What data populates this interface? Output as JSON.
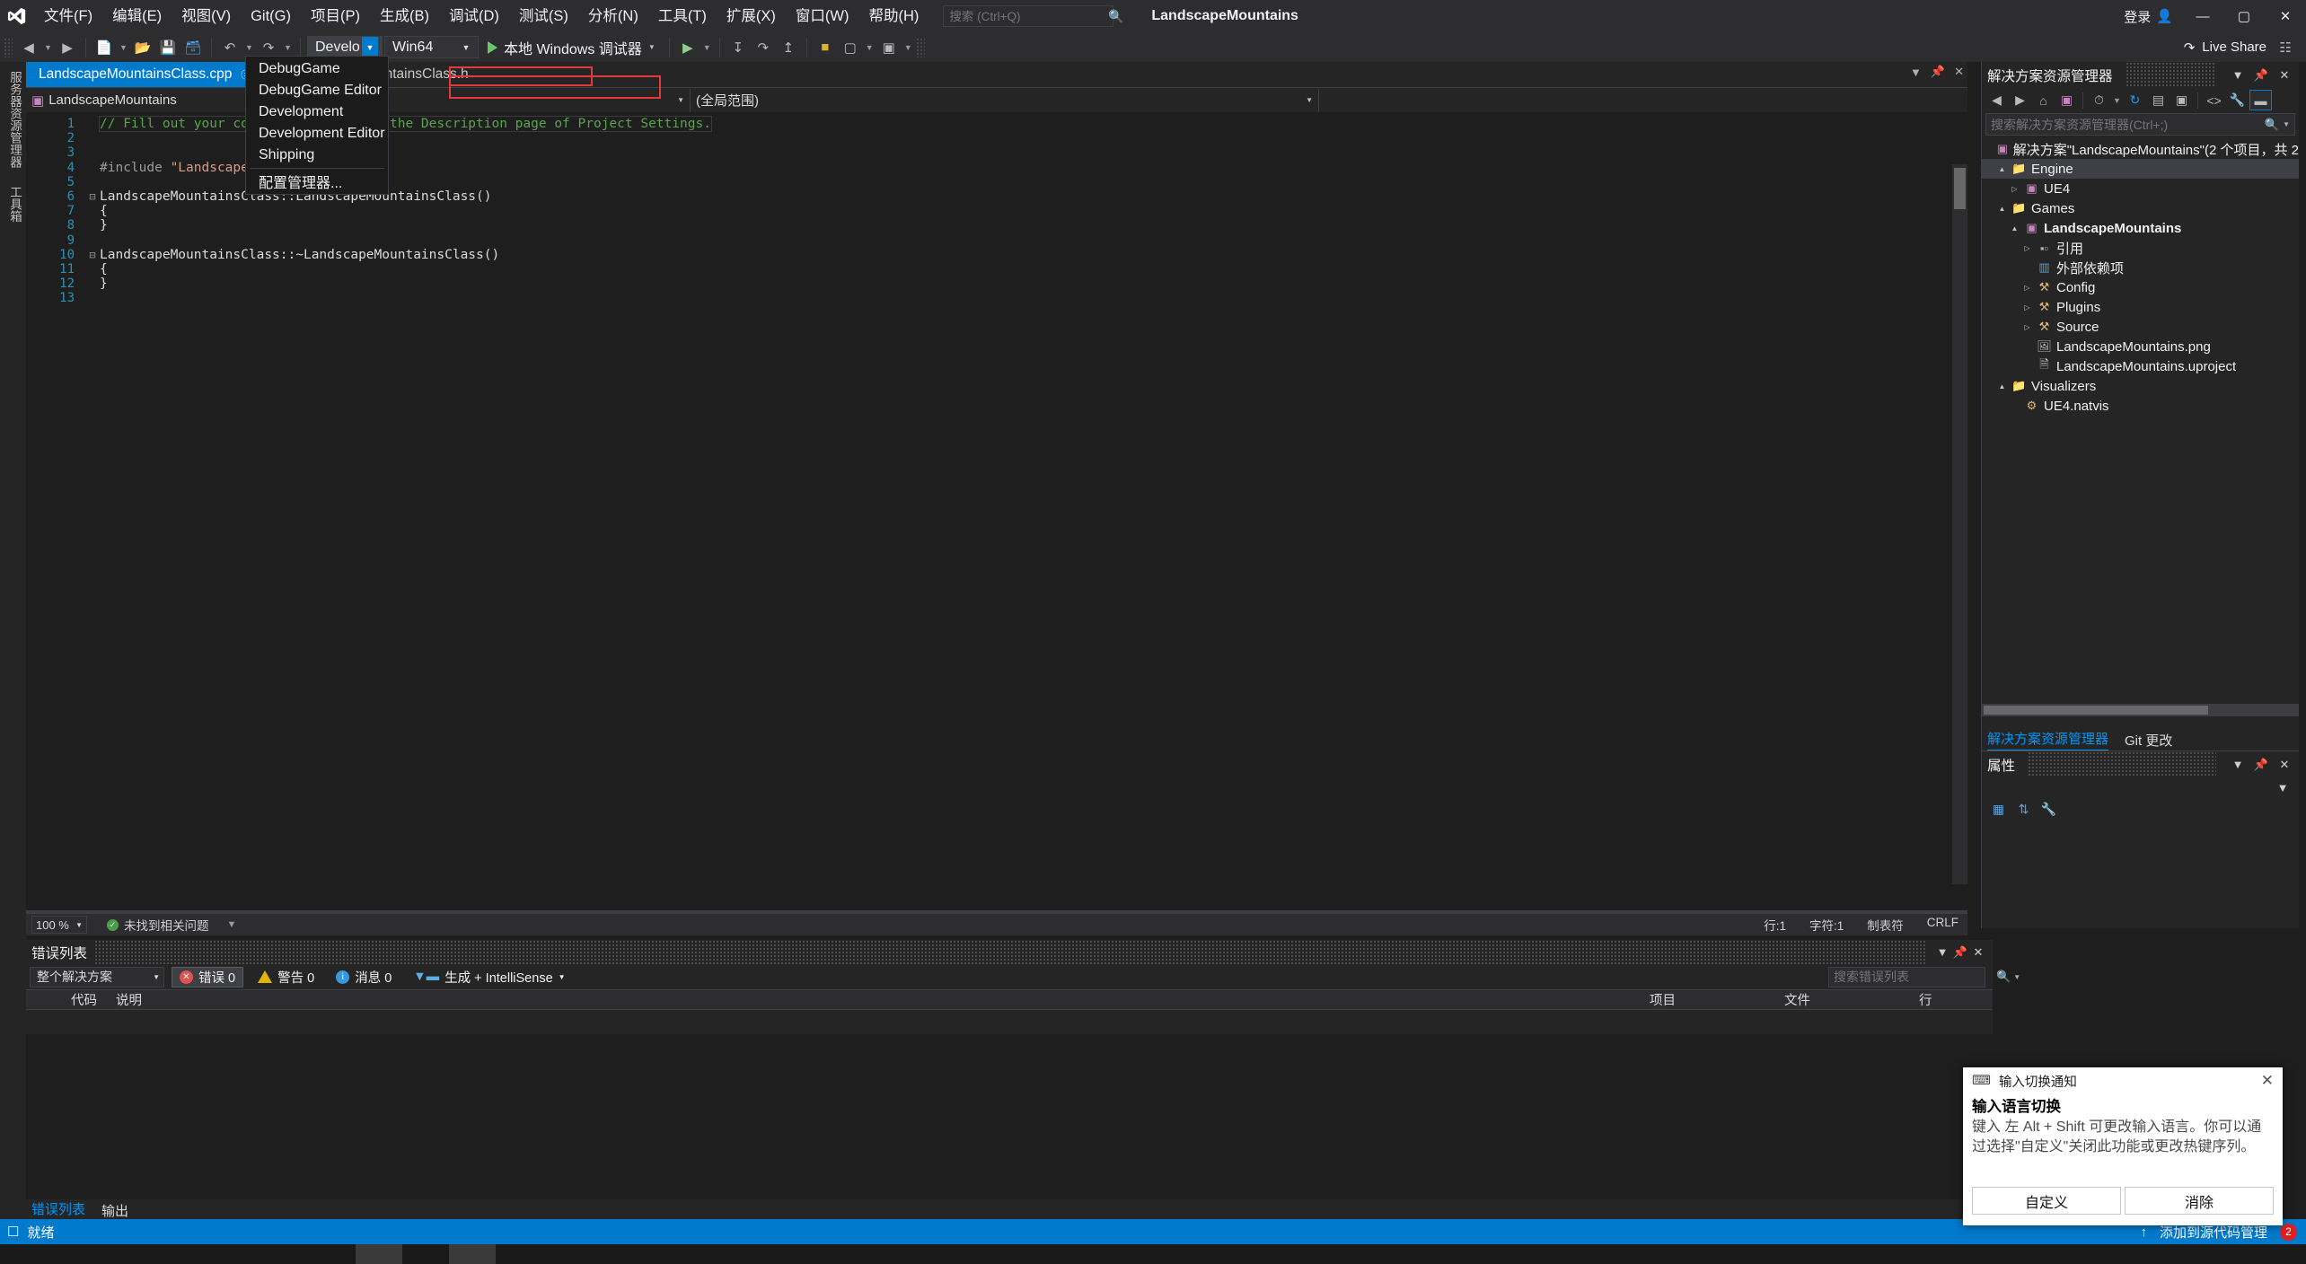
{
  "titlebar": {
    "menus": [
      "文件(F)",
      "编辑(E)",
      "视图(V)",
      "Git(G)",
      "项目(P)",
      "生成(B)",
      "调试(D)",
      "测试(S)",
      "分析(N)",
      "工具(T)",
      "扩展(X)",
      "窗口(W)",
      "帮助(H)"
    ],
    "search_placeholder": "搜索 (Ctrl+Q)",
    "search_value": "",
    "solution_name": "LandscapeMountains",
    "signin_label": "登录",
    "minimize": "—",
    "maximize": "▢",
    "close": "✕"
  },
  "toolbar": {
    "config_value": "Develo",
    "platform_value": "Win64",
    "run_label": "本地 Windows 调试器",
    "live_share": "Live Share"
  },
  "config_menu": {
    "items": [
      "DebugGame",
      "DebugGame Editor",
      "Development",
      "Development Editor",
      "Shipping"
    ],
    "manager": "配置管理器..."
  },
  "left_tabs": [
    "服务器资源管理器",
    "工具箱"
  ],
  "editor": {
    "tab_active": "LandscapeMountainsClass.cpp",
    "tab_inactive": "LandscapeMountainsClass.h",
    "nav_left": "LandscapeMountains",
    "nav_right": "(全局范围)",
    "lines": [
      {
        "num": "1",
        "fold": "",
        "text": "// Fill out your copyright notice in the Description page of Project Settings.",
        "kind": "comment"
      },
      {
        "num": "2",
        "fold": "",
        "text": "",
        "kind": "plain"
      },
      {
        "num": "3",
        "fold": "",
        "text": "",
        "kind": "plain"
      },
      {
        "num": "4",
        "fold": "",
        "text": "#include \"LandscapeMountainsClass.h\"",
        "kind": "include"
      },
      {
        "num": "5",
        "fold": "",
        "text": "",
        "kind": "plain"
      },
      {
        "num": "6",
        "fold": "⊟",
        "text": "LandscapeMountainsClass::LandscapeMountainsClass()",
        "kind": "plain"
      },
      {
        "num": "7",
        "fold": "",
        "text": "{",
        "kind": "plain"
      },
      {
        "num": "8",
        "fold": "",
        "text": "}",
        "kind": "plain"
      },
      {
        "num": "9",
        "fold": "",
        "text": "",
        "kind": "plain"
      },
      {
        "num": "10",
        "fold": "⊟",
        "text": "LandscapeMountainsClass::~LandscapeMountainsClass()",
        "kind": "plain"
      },
      {
        "num": "11",
        "fold": "",
        "text": "{",
        "kind": "plain"
      },
      {
        "num": "12",
        "fold": "",
        "text": "}",
        "kind": "plain"
      },
      {
        "num": "13",
        "fold": "",
        "text": "",
        "kind": "plain"
      }
    ],
    "status": {
      "zoom": "100 %",
      "diagnostics": "未找到相关问题",
      "line": "行:1",
      "col": "字符:1",
      "tabs": "制表符",
      "eol": "CRLF"
    }
  },
  "solution_explorer": {
    "title": "解决方案资源管理器",
    "search_placeholder": "搜索解决方案资源管理器(Ctrl+;)",
    "root": "解决方案\"LandscapeMountains\"(2 个项目，共 2",
    "nodes": [
      {
        "depth": 1,
        "arrow": "▲",
        "icon": "folder",
        "label": "Engine",
        "bold": false,
        "selected": true
      },
      {
        "depth": 2,
        "arrow": "▷",
        "icon": "project",
        "label": "UE4",
        "bold": false,
        "selected": false
      },
      {
        "depth": 1,
        "arrow": "▲",
        "icon": "folder",
        "label": "Games",
        "bold": false,
        "selected": false
      },
      {
        "depth": 2,
        "arrow": "▲",
        "icon": "project",
        "label": "LandscapeMountains",
        "bold": true,
        "selected": false
      },
      {
        "depth": 3,
        "arrow": "▷",
        "icon": "ref",
        "label": "引用",
        "bold": false,
        "selected": false
      },
      {
        "depth": 3,
        "arrow": "",
        "icon": "extdep",
        "label": "外部依赖项",
        "bold": false,
        "selected": false
      },
      {
        "depth": 3,
        "arrow": "▷",
        "icon": "filter",
        "label": "Config",
        "bold": false,
        "selected": false
      },
      {
        "depth": 3,
        "arrow": "▷",
        "icon": "filter",
        "label": "Plugins",
        "bold": false,
        "selected": false
      },
      {
        "depth": 3,
        "arrow": "▷",
        "icon": "filter",
        "label": "Source",
        "bold": false,
        "selected": false
      },
      {
        "depth": 3,
        "arrow": "",
        "icon": "image",
        "label": "LandscapeMountains.png",
        "bold": false,
        "selected": false
      },
      {
        "depth": 3,
        "arrow": "",
        "icon": "file",
        "label": "LandscapeMountains.uproject",
        "bold": false,
        "selected": false
      },
      {
        "depth": 1,
        "arrow": "▲",
        "icon": "folder",
        "label": "Visualizers",
        "bold": false,
        "selected": false
      },
      {
        "depth": 2,
        "arrow": "",
        "icon": "natvis",
        "label": "UE4.natvis",
        "bold": false,
        "selected": false
      }
    ],
    "tab_solution": "解决方案资源管理器",
    "tab_git": "Git 更改"
  },
  "properties": {
    "title": "属性"
  },
  "error_list": {
    "title": "错误列表",
    "scope_value": "整个解决方案",
    "errors_label": "错误 0",
    "warnings_label": "警告 0",
    "messages_label": "消息 0",
    "build_filter": "生成 + IntelliSense",
    "search_placeholder": "搜索错误列表",
    "columns": [
      "",
      "代码",
      "说明",
      "项目",
      "文件",
      "行"
    ],
    "rows": [],
    "tab_errors": "错误列表",
    "tab_output": "输出"
  },
  "toast": {
    "header": "输入切换通知",
    "title": "输入语言切换",
    "body": "键入 左 Alt + Shift 可更改输入语言。你可以通过选择\"自定义\"关闭此功能或更改热键序列。",
    "btn_customize": "自定义",
    "btn_dismiss": "消除",
    "close": "✕"
  },
  "statusbar": {
    "ready": "就绪",
    "add_source": "添加到源代码管理",
    "badge": "2"
  },
  "colors": {
    "accent": "#007acc",
    "titlebar_bg": "#2d2d30",
    "editor_bg": "#1e1e1e",
    "panel_bg": "#252526",
    "comment_green": "#57a64a",
    "string_orange": "#d69d85",
    "linenum_blue": "#2b91af",
    "folder_gold": "#dcb67a",
    "error_red": "#e05252"
  }
}
